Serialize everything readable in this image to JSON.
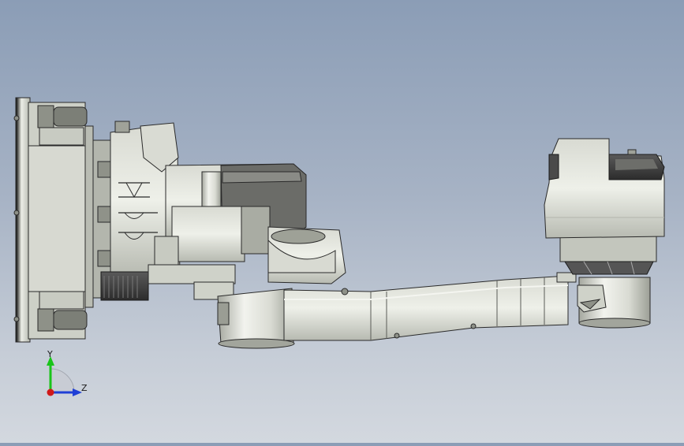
{
  "triad": {
    "y_label": "Y",
    "z_label": "Z",
    "colors": {
      "y_axis": "#19c419",
      "z_axis": "#1f3fd6",
      "x_axis": "#d01919"
    }
  },
  "model": {
    "colors": {
      "light": "#e4e6de",
      "mid": "#c2c5bc",
      "shade": "#9ea197",
      "dark": "#3f3f3f",
      "edge": "#2a2a2a"
    }
  }
}
